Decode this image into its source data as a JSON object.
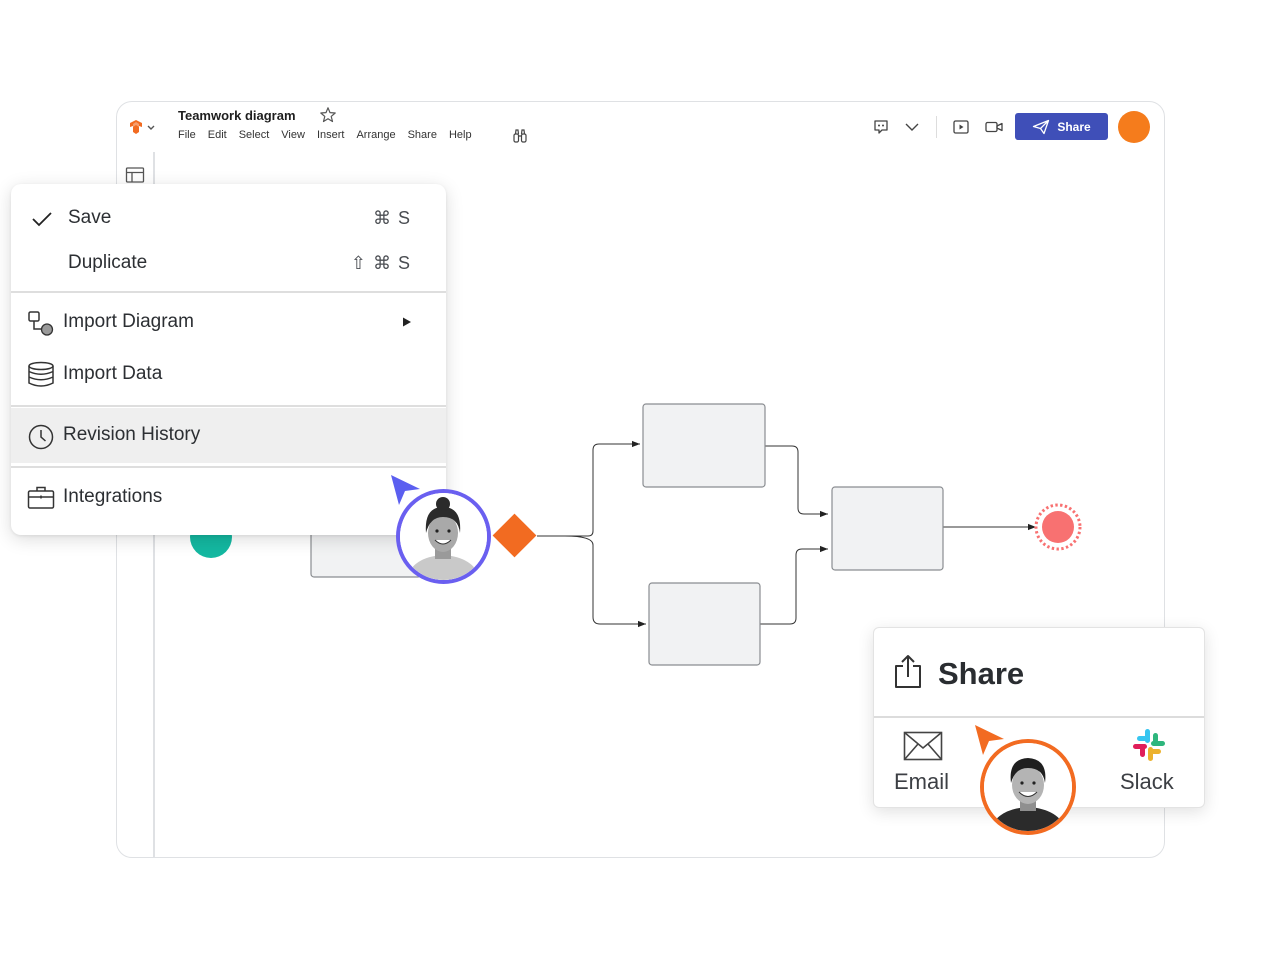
{
  "document": {
    "title": "Teamwork diagram"
  },
  "menubar": {
    "items": [
      "File",
      "Edit",
      "Select",
      "View",
      "Insert",
      "Arrange",
      "Share",
      "Help"
    ]
  },
  "header": {
    "share_label": "Share",
    "icons": [
      "comment-icon",
      "chevron-down-icon",
      "present-icon",
      "video-icon"
    ],
    "avatar_color": "#f57c1c"
  },
  "file_menu": {
    "items": [
      {
        "label": "Save",
        "shortcut": "⌘ S",
        "checked": true
      },
      {
        "label": "Duplicate",
        "shortcut": "⇧ ⌘ S"
      },
      {
        "label": "Import Diagram",
        "submenu": true,
        "icon": "import-diagram-icon"
      },
      {
        "label": "Import Data",
        "icon": "database-icon"
      },
      {
        "label": "Revision History",
        "icon": "clock-icon",
        "highlighted": true
      },
      {
        "label": "Integrations",
        "icon": "briefcase-icon"
      }
    ]
  },
  "share_panel": {
    "title": "Share",
    "options": [
      {
        "label": "Email",
        "icon": "envelope-icon"
      },
      {
        "label": "Slack",
        "icon": "slack-icon"
      }
    ]
  },
  "colors": {
    "accent": "#3f4fb8",
    "orange": "#f57c1c",
    "teal": "#14b8a1",
    "end_event": "#f87171",
    "cursor_purple": "#5b5ff0",
    "node_fill": "#f1f2f3",
    "node_stroke": "#8a8d91"
  }
}
